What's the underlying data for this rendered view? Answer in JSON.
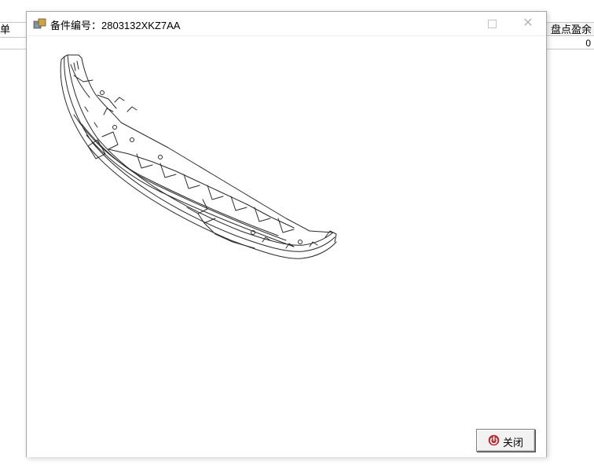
{
  "background": {
    "left_header_text": "单",
    "right_header_text": "盘点盈余",
    "right_cell_value": "0"
  },
  "window": {
    "title": "备件编号：2803132XKZ7AA",
    "close_button_label": "关闭"
  },
  "colors": {
    "close_icon_red": "#c0282d",
    "drawing_stroke": "#2a2a2a"
  }
}
